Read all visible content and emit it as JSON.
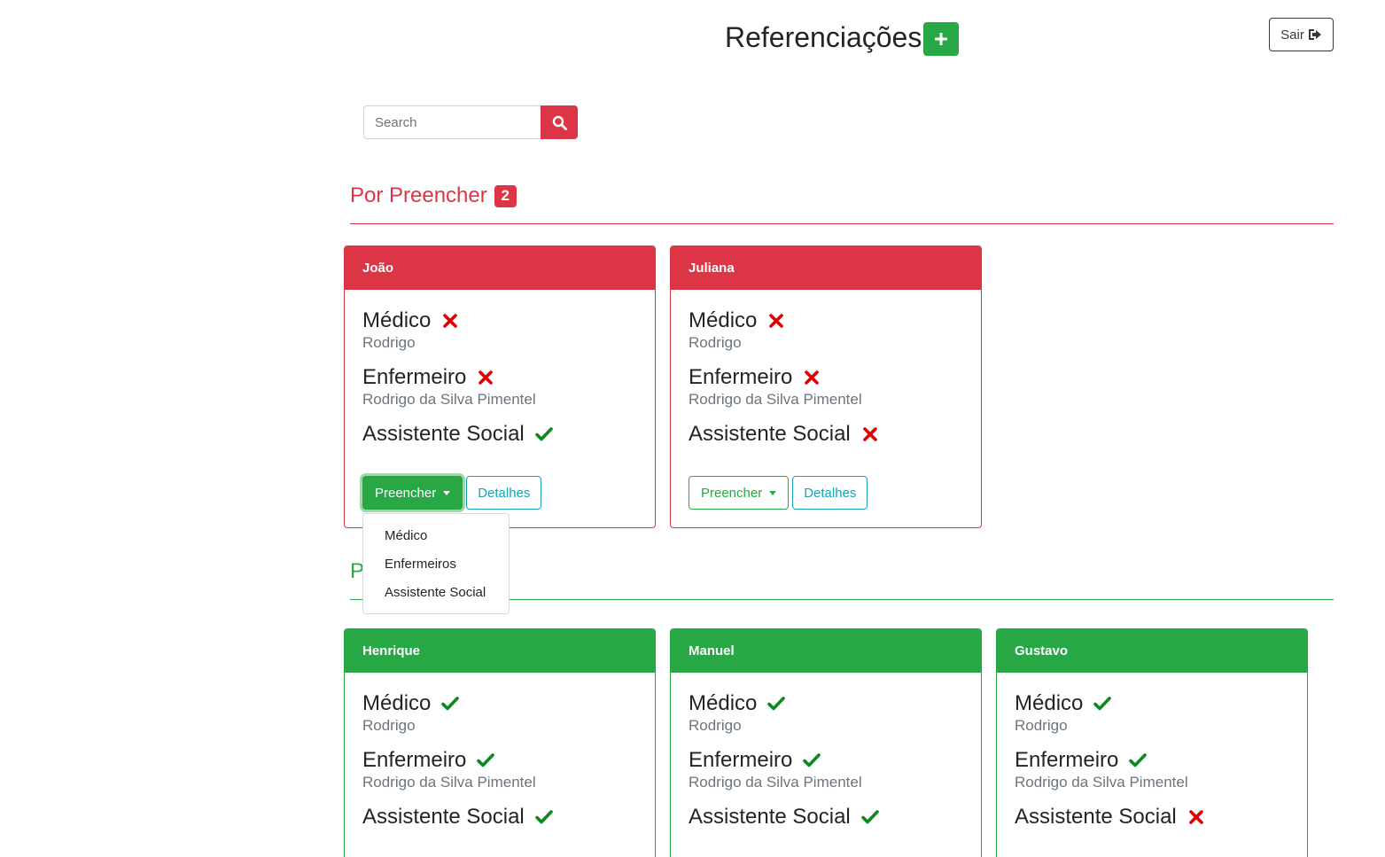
{
  "header": {
    "title": "Referenciações",
    "logout_label": "Sair"
  },
  "search": {
    "placeholder": "Search"
  },
  "sections": {
    "pending": {
      "label": "Por Preencher",
      "count": "2"
    },
    "filled": {
      "label": "P"
    }
  },
  "actions": {
    "fill_label": "Preencher",
    "details_label": "Detalhes"
  },
  "dropdown": {
    "items": [
      "Médico",
      "Enfermeiros",
      "Assistente Social"
    ]
  },
  "roles": {
    "doctor": "Médico",
    "nurse": "Enfermeiro",
    "social": "Assistente Social"
  },
  "pending_cards": [
    {
      "name": "João",
      "doctor_name": "Rodrigo",
      "nurse_name": "Rodrigo da Silva Pimentel",
      "doctor_done": false,
      "nurse_done": false,
      "social_done": true
    },
    {
      "name": "Juliana",
      "doctor_name": "Rodrigo",
      "nurse_name": "Rodrigo da Silva Pimentel",
      "doctor_done": false,
      "nurse_done": false,
      "social_done": false
    }
  ],
  "filled_cards": [
    {
      "name": "Henrique",
      "doctor_name": "Rodrigo",
      "nurse_name": "Rodrigo da Silva Pimentel",
      "doctor_done": true,
      "nurse_done": true,
      "social_done": true
    },
    {
      "name": "Manuel",
      "doctor_name": "Rodrigo",
      "nurse_name": "Rodrigo da Silva Pimentel",
      "doctor_done": true,
      "nurse_done": true,
      "social_done": true
    },
    {
      "name": "Gustavo",
      "doctor_name": "Rodrigo",
      "nurse_name": "Rodrigo da Silva Pimentel",
      "doctor_done": true,
      "nurse_done": true,
      "social_done": false
    }
  ],
  "colors": {
    "danger": "#dc3545",
    "success": "#28a745",
    "info": "#17a2b8",
    "check": "#28a745",
    "cross": "#e00000"
  }
}
